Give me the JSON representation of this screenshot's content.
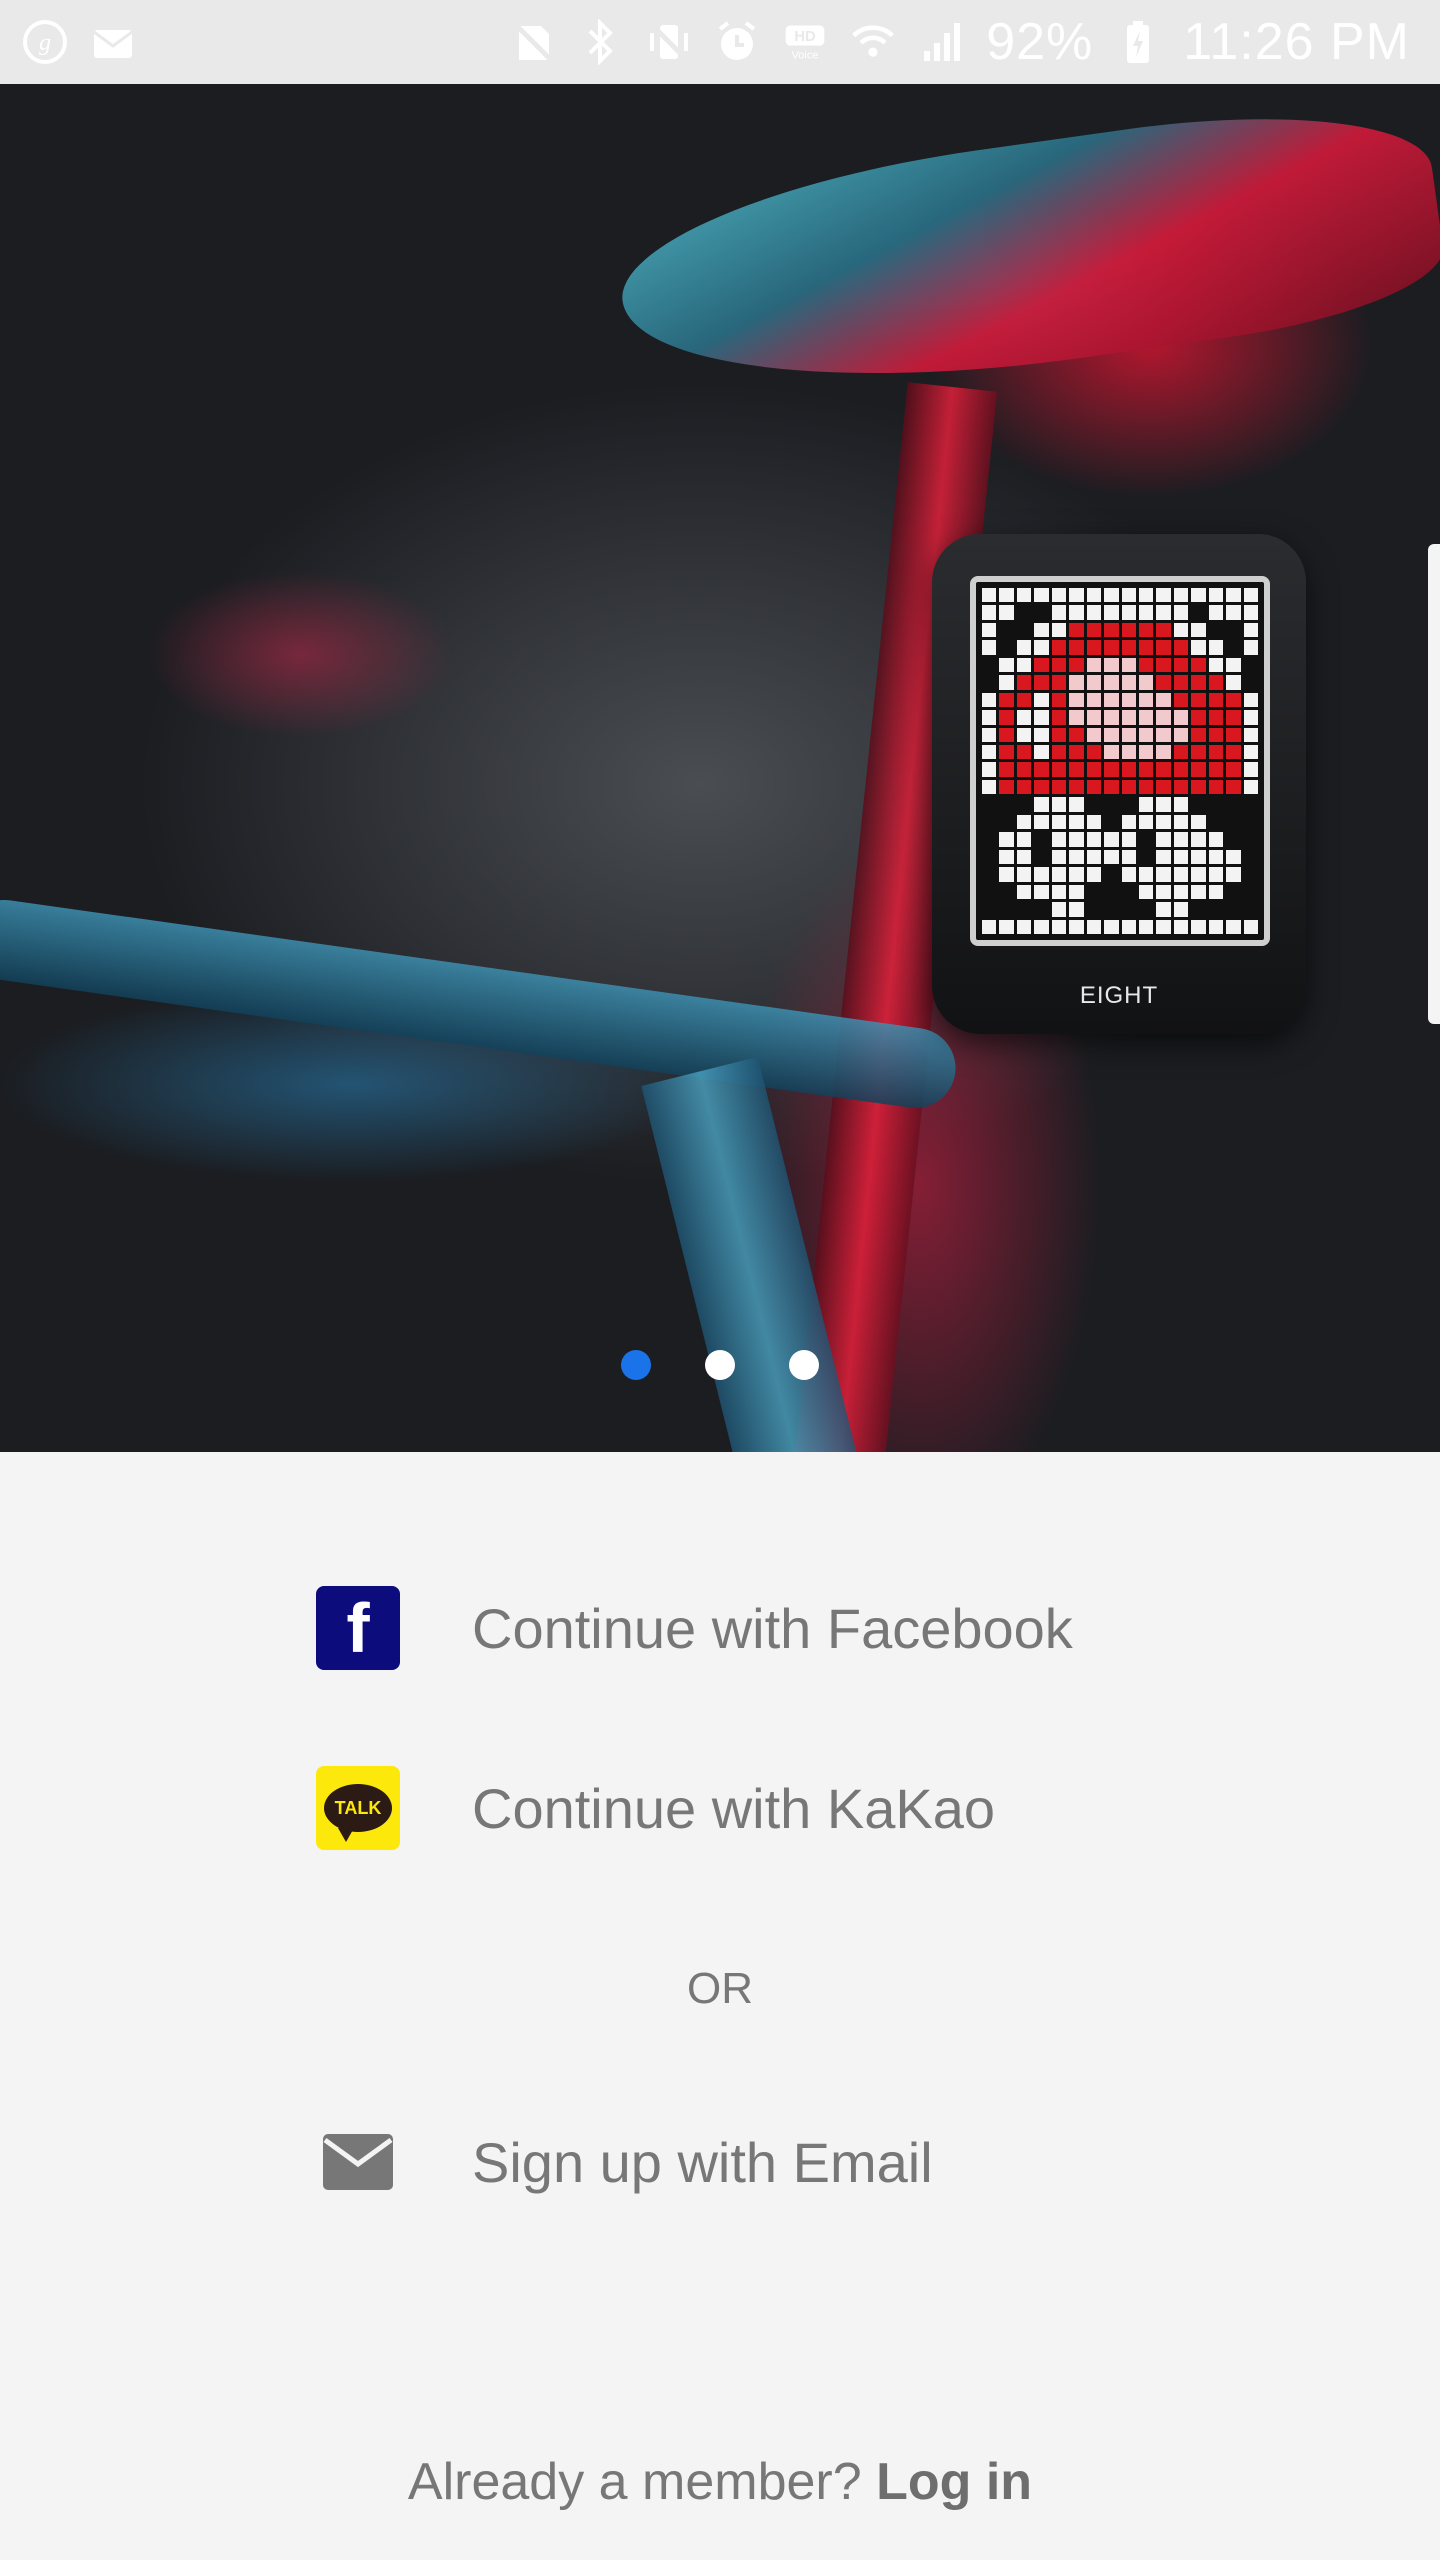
{
  "status_bar": {
    "battery": "92%",
    "time": "11:26 PM",
    "left_icons": [
      "g-app-icon",
      "mail-notification-icon"
    ],
    "right_icons": [
      "no-sim-icon",
      "bluetooth-icon",
      "vibrate-icon",
      "alarm-icon",
      "hd-voice-icon",
      "wifi-icon",
      "signal-icon",
      "battery-charging-icon"
    ]
  },
  "hero": {
    "device_label": "EIGHT",
    "carousel": {
      "pages": 3,
      "active_index": 0
    },
    "colors": {
      "active_dot": "#1a73e8",
      "inactive_dot": "#ffffff"
    }
  },
  "auth": {
    "facebook_label": "Continue with Facebook",
    "facebook_icon_glyph": "f",
    "kakao_label": "Continue with KaKao",
    "kakao_icon_text": "TALK",
    "or_label": "OR",
    "email_label": "Sign up with Email",
    "colors": {
      "facebook": "#0c0c7c",
      "kakao": "#fde80b",
      "text": "#777777"
    }
  },
  "footer": {
    "prompt": "Already a member?",
    "login_label": "Log in"
  }
}
